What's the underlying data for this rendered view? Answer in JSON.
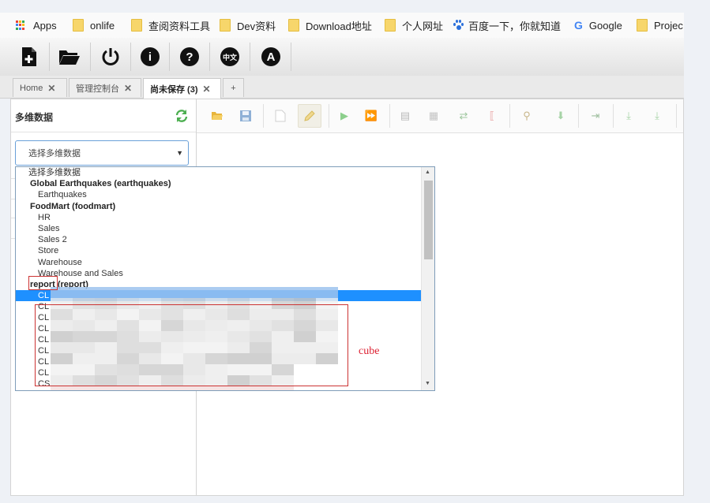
{
  "bookmarks": {
    "items": [
      {
        "label": "Apps",
        "icon": "apps-grid-icon"
      },
      {
        "label": "onlife",
        "icon": "folder-icon"
      },
      {
        "label": "查阅资料工具",
        "icon": "folder-icon"
      },
      {
        "label": "Dev资料",
        "icon": "folder-icon"
      },
      {
        "label": "Download地址",
        "icon": "folder-icon"
      },
      {
        "label": "个人网址",
        "icon": "folder-icon"
      },
      {
        "label": "百度一下，你就知道",
        "icon": "baidu-paw-icon"
      },
      {
        "label": "Google",
        "icon": "google-icon"
      },
      {
        "label": "Projec",
        "icon": "folder-icon"
      }
    ]
  },
  "toolbar": {
    "icons": [
      "new-file-icon",
      "open-folder-icon",
      "power-icon",
      "info-icon",
      "help-icon",
      "language-icon",
      "font-icon"
    ],
    "language_badge": "中文",
    "font_badge": "A",
    "info_badge": "i",
    "help_badge": "?"
  },
  "tabs": [
    {
      "label": "Home",
      "active": false
    },
    {
      "label": "管理控制台",
      "active": false
    },
    {
      "label": "尚未保存 (3)",
      "active": true
    },
    {
      "label": "+",
      "active": false
    }
  ],
  "left_panel": {
    "title": "多维数据",
    "select": {
      "value": "选择多维数据"
    }
  },
  "dropdown": {
    "placeholder": "选择多维数据",
    "groups": [
      {
        "label": "Global Earthquakes (earthquakes)",
        "items": [
          "Earthquakes"
        ]
      },
      {
        "label": "FoodMart (foodmart)",
        "items": [
          "HR",
          "Sales",
          "Sales 2",
          "Store",
          "Warehouse",
          "Warehouse and Sales"
        ]
      },
      {
        "label": "report (report)",
        "items": [
          "CL",
          "CL",
          "CL",
          "CL",
          "CL",
          "CL",
          "CL",
          "CL",
          "CS"
        ]
      }
    ],
    "selected": "CL"
  },
  "annotation": {
    "label": "cube"
  },
  "colors": {
    "selection": "#1e90ff",
    "annotation": "#cc3333",
    "accent": "#4a90d9"
  }
}
